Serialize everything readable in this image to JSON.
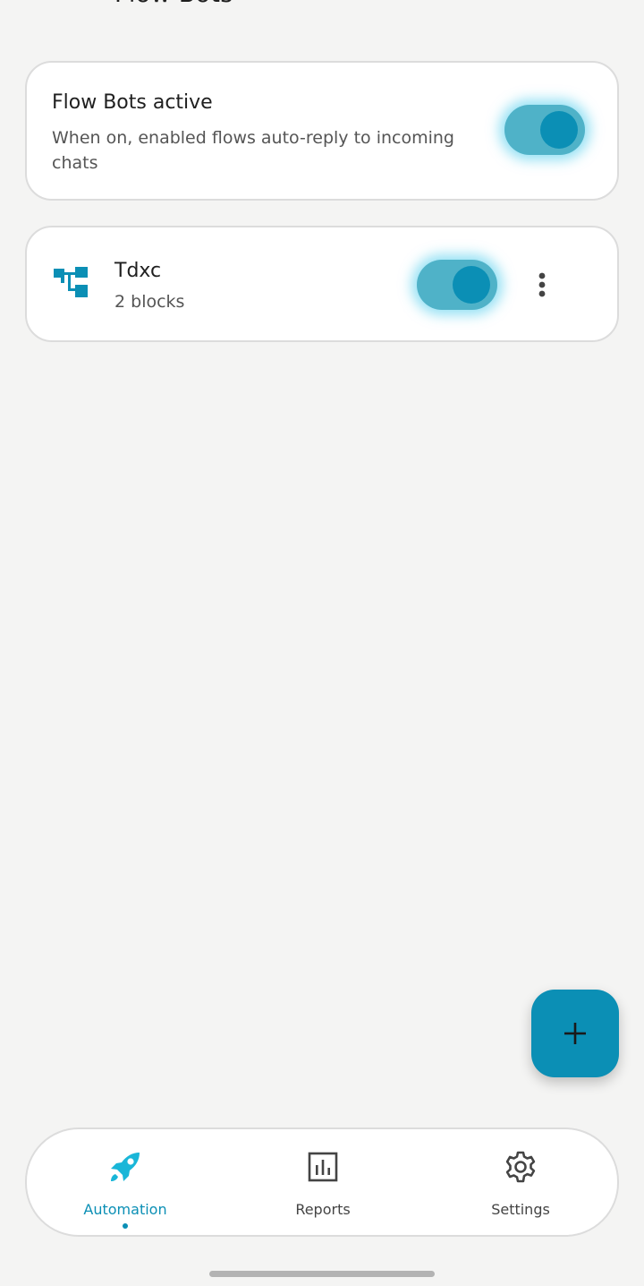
{
  "app_bar": {
    "title": "Flow Bots",
    "back_icon": "arrow-back-icon"
  },
  "master_toggle": {
    "title": "Flow Bots active",
    "description": "When on, enabled flows auto-reply to incoming chats",
    "enabled": true
  },
  "flows": [
    {
      "name": "Tdxc",
      "meta": "2 blocks",
      "enabled": true,
      "icon": "flow-tree-icon",
      "menu_icon": "more-vert-icon"
    }
  ],
  "fab": {
    "icon": "plus-icon"
  },
  "bottom_nav": {
    "items": [
      {
        "label": "Automation",
        "icon": "rocket-icon",
        "active": true
      },
      {
        "label": "Reports",
        "icon": "bar-chart-icon",
        "active": false
      },
      {
        "label": "Settings",
        "icon": "gear-icon",
        "active": false
      }
    ]
  },
  "colors": {
    "accent": "#0b8fb5",
    "toggle_track": "#4fb2c8",
    "background": "#f4f4f3",
    "card": "#ffffff",
    "card_border": "#dcdcdc"
  }
}
